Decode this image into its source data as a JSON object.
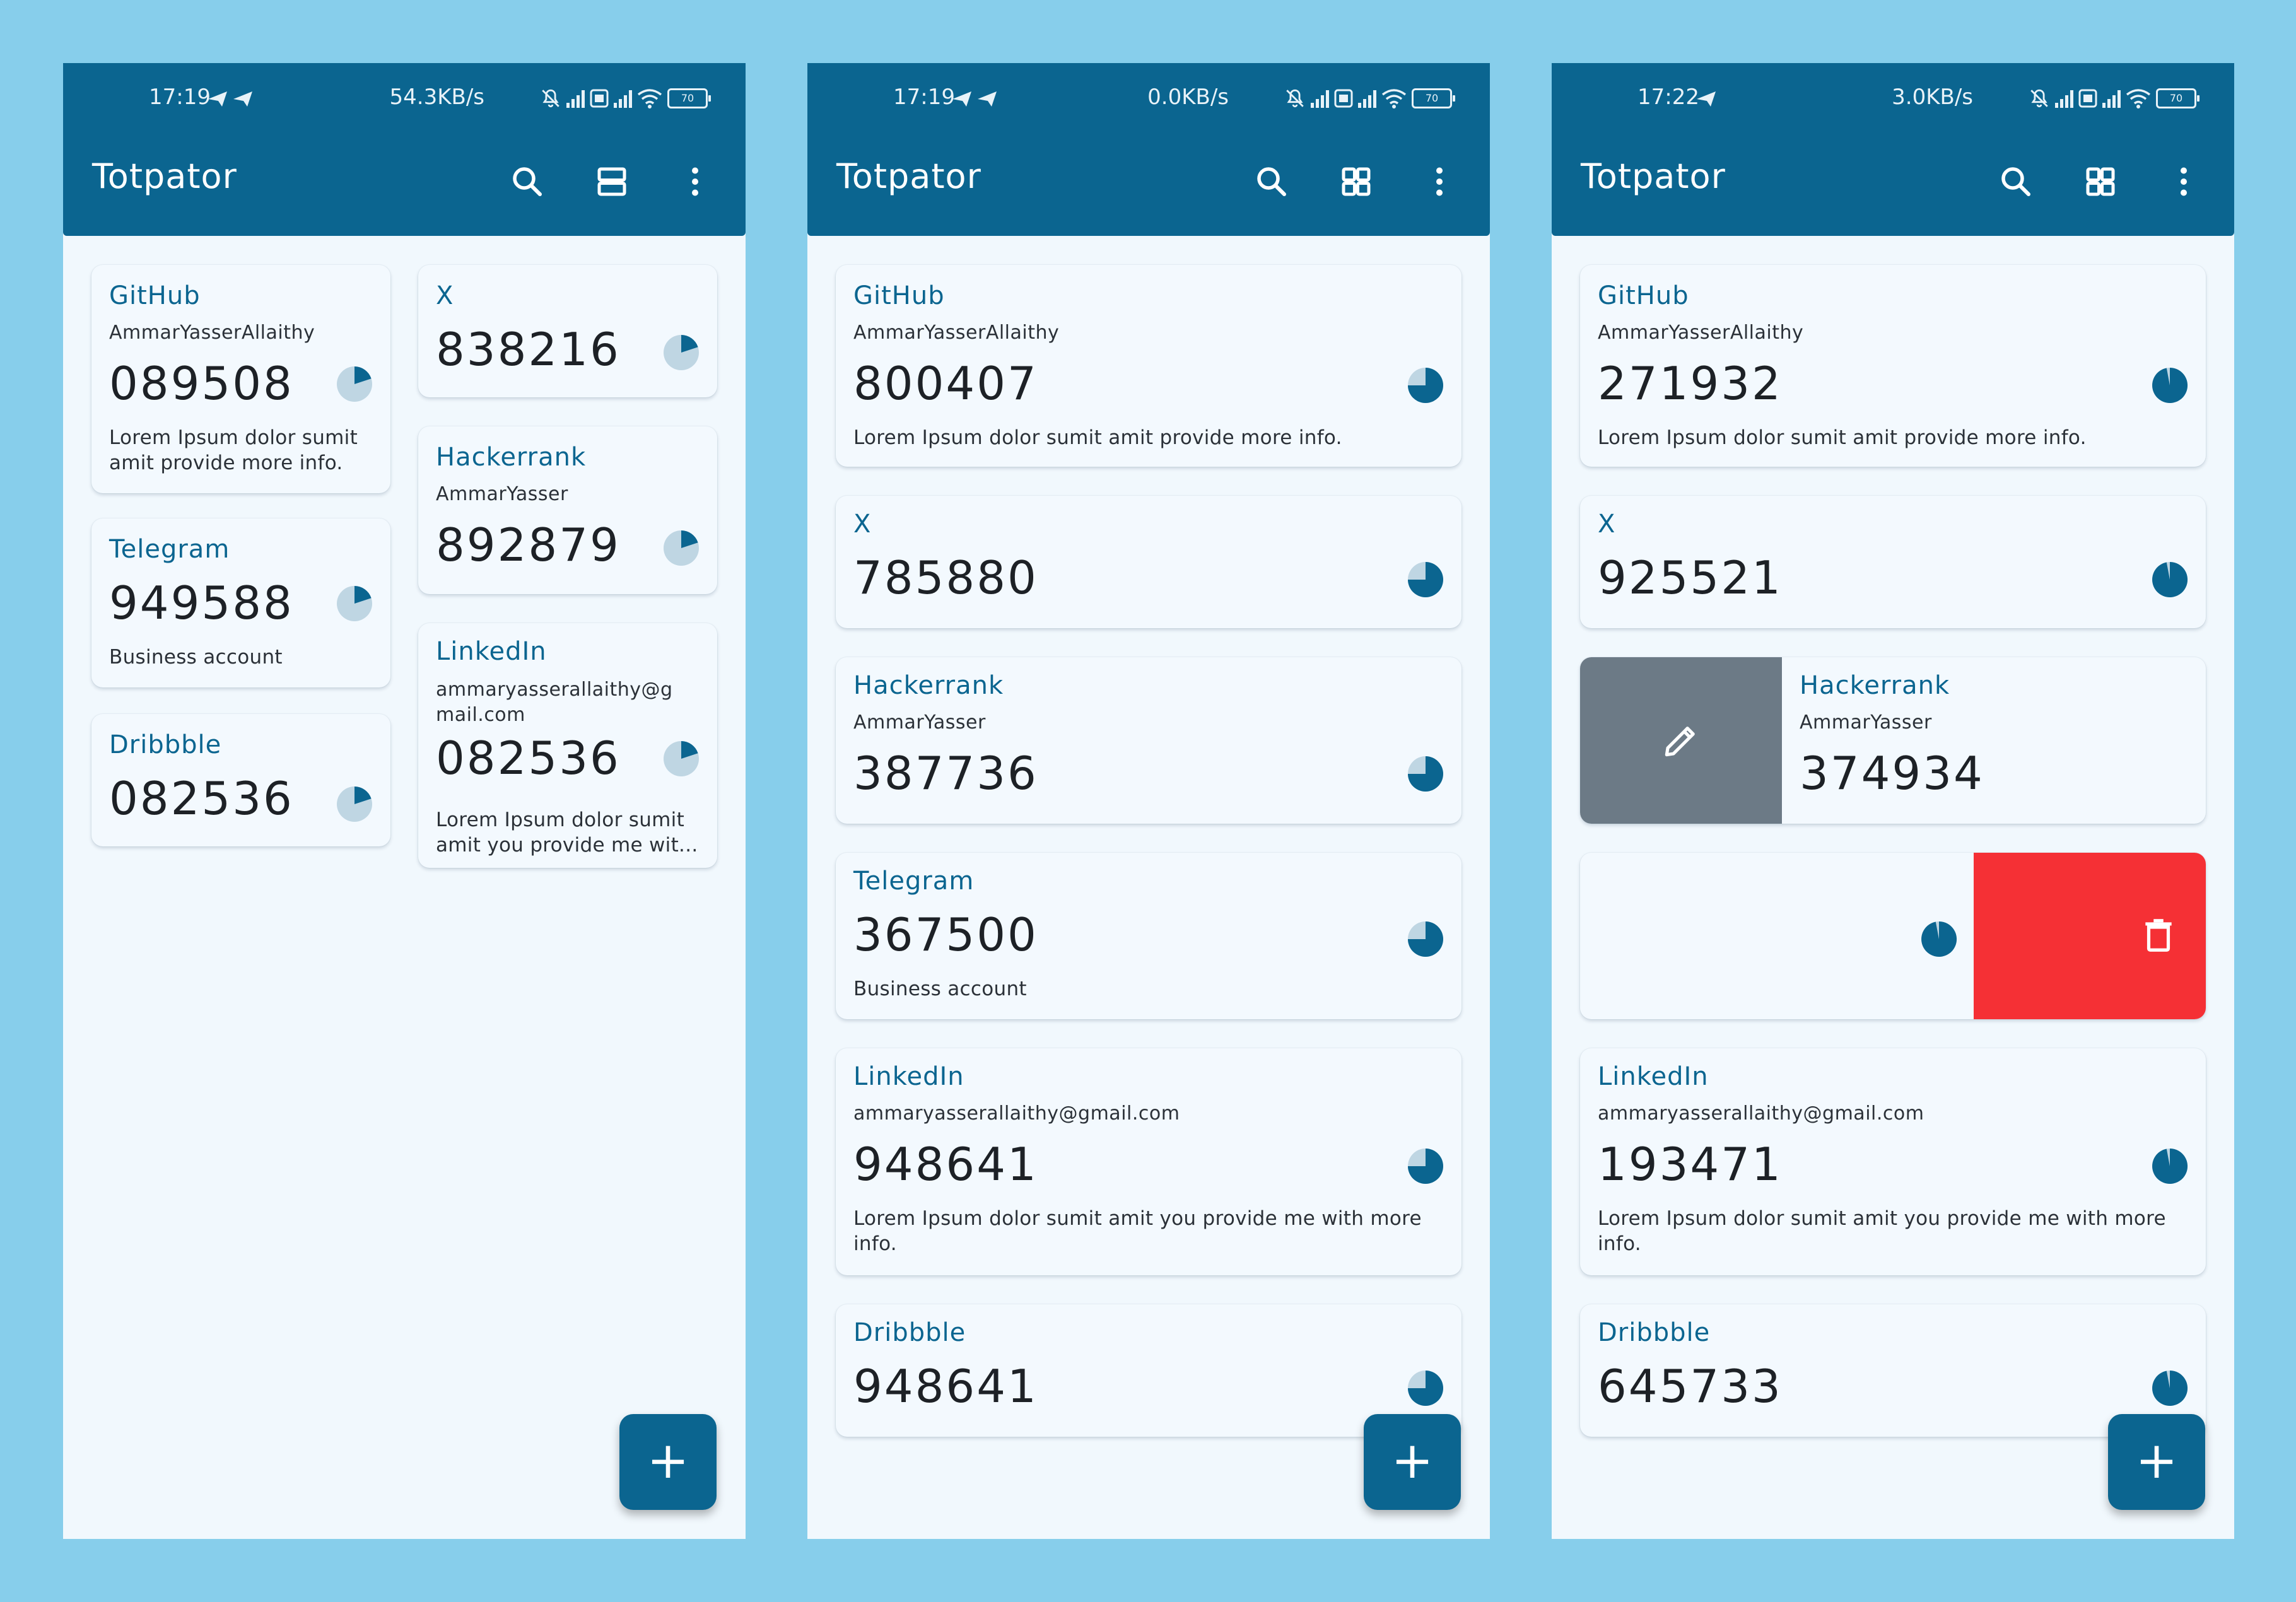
{
  "app": {
    "title": "Totpator"
  },
  "colors": {
    "primary": "#0B6590",
    "background": "#87CEEB",
    "surface": "#F1F8FD",
    "delete": "#F53035",
    "edit": "#6C7A86"
  },
  "screens": [
    {
      "status": {
        "time": "17:19",
        "speed": "54.3KB/s",
        "battery": "70"
      },
      "layout_toggle_icon": "list-view-icon",
      "cards": [
        {
          "issuer": "GitHub",
          "account": "AmmarYasserAllaithy",
          "code": "089508",
          "note": "Lorem Ipsum dolor sumit amit provide more info.",
          "timer_fraction": 0.3
        },
        {
          "issuer": "X",
          "code": "838216",
          "timer_fraction": 0.3
        },
        {
          "issuer": "Hackerrank",
          "account": "AmmarYasser",
          "code": "892879",
          "timer_fraction": 0.3
        },
        {
          "issuer": "Telegram",
          "code": "949588",
          "note": "Business account",
          "timer_fraction": 0.3
        },
        {
          "issuer": "LinkedIn",
          "account": "ammaryasserallaithy@g mail.com",
          "code": "082536",
          "note": "Lorem Ipsum dolor sumit amit you provide me wit...",
          "timer_fraction": 0.3
        },
        {
          "issuer": "Dribbble",
          "code": "082536",
          "timer_fraction": 0.3
        }
      ],
      "fab_label": "+"
    },
    {
      "status": {
        "time": "17:19",
        "speed": "0.0KB/s",
        "battery": "70"
      },
      "layout_toggle_icon": "grid-view-icon",
      "cards": [
        {
          "issuer": "GitHub",
          "account": "AmmarYasserAllaithy",
          "code": "800407",
          "note": "Lorem Ipsum dolor sumit amit provide more info.",
          "timer_fraction": 0.75
        },
        {
          "issuer": "X",
          "code": "785880",
          "timer_fraction": 0.75
        },
        {
          "issuer": "Hackerrank",
          "account": "AmmarYasser",
          "code": "387736",
          "timer_fraction": 0.75
        },
        {
          "issuer": "Telegram",
          "code": "367500",
          "note": "Business account",
          "timer_fraction": 0.75
        },
        {
          "issuer": "LinkedIn",
          "account": "ammaryasserallaithy@gmail.com",
          "code": "948641",
          "note": "Lorem Ipsum dolor sumit amit you provide me with more info.",
          "timer_fraction": 0.75
        },
        {
          "issuer": "Dribbble",
          "code": "948641",
          "timer_fraction": 0.75
        }
      ],
      "fab_label": "+"
    },
    {
      "status": {
        "time": "17:22",
        "speed": "3.0KB/s",
        "battery": "70"
      },
      "layout_toggle_icon": "grid-view-icon",
      "cards": [
        {
          "issuer": "GitHub",
          "account": "AmmarYasserAllaithy",
          "code": "271932",
          "note": "Lorem Ipsum dolor sumit amit provide more info.",
          "timer_fraction": 0.97
        },
        {
          "issuer": "X",
          "code": "925521",
          "timer_fraction": 0.97
        },
        {
          "issuer": "Hackerrank",
          "account": "AmmarYasser",
          "code": "374934",
          "timer_fraction": 0.97,
          "swipe": "edit"
        },
        {
          "timer_fraction": 0.97,
          "swipe": "delete"
        },
        {
          "issuer": "LinkedIn",
          "account": "ammaryasserallaithy@gmail.com",
          "code": "193471",
          "note": "Lorem Ipsum dolor sumit amit you provide me with more info.",
          "timer_fraction": 0.97
        },
        {
          "issuer": "Dribbble",
          "code": "645733",
          "timer_fraction": 0.97
        }
      ],
      "fab_label": "+"
    }
  ]
}
